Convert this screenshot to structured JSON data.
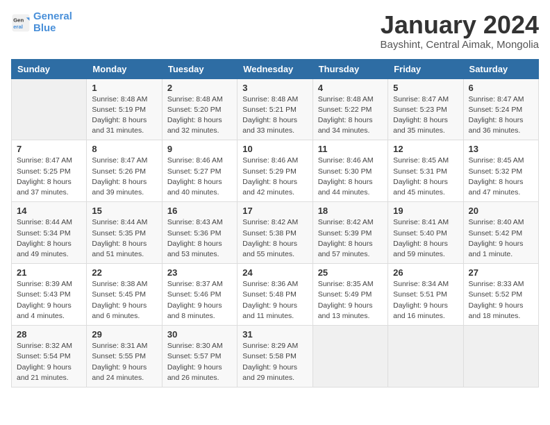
{
  "logo": {
    "line1": "General",
    "line2": "Blue"
  },
  "title": "January 2024",
  "subtitle": "Bayshint, Central Aimak, Mongolia",
  "days_header": [
    "Sunday",
    "Monday",
    "Tuesday",
    "Wednesday",
    "Thursday",
    "Friday",
    "Saturday"
  ],
  "weeks": [
    [
      {
        "num": "",
        "sunrise": "",
        "sunset": "",
        "daylight": ""
      },
      {
        "num": "1",
        "sunrise": "Sunrise: 8:48 AM",
        "sunset": "Sunset: 5:19 PM",
        "daylight": "Daylight: 8 hours and 31 minutes."
      },
      {
        "num": "2",
        "sunrise": "Sunrise: 8:48 AM",
        "sunset": "Sunset: 5:20 PM",
        "daylight": "Daylight: 8 hours and 32 minutes."
      },
      {
        "num": "3",
        "sunrise": "Sunrise: 8:48 AM",
        "sunset": "Sunset: 5:21 PM",
        "daylight": "Daylight: 8 hours and 33 minutes."
      },
      {
        "num": "4",
        "sunrise": "Sunrise: 8:48 AM",
        "sunset": "Sunset: 5:22 PM",
        "daylight": "Daylight: 8 hours and 34 minutes."
      },
      {
        "num": "5",
        "sunrise": "Sunrise: 8:47 AM",
        "sunset": "Sunset: 5:23 PM",
        "daylight": "Daylight: 8 hours and 35 minutes."
      },
      {
        "num": "6",
        "sunrise": "Sunrise: 8:47 AM",
        "sunset": "Sunset: 5:24 PM",
        "daylight": "Daylight: 8 hours and 36 minutes."
      }
    ],
    [
      {
        "num": "7",
        "sunrise": "Sunrise: 8:47 AM",
        "sunset": "Sunset: 5:25 PM",
        "daylight": "Daylight: 8 hours and 37 minutes."
      },
      {
        "num": "8",
        "sunrise": "Sunrise: 8:47 AM",
        "sunset": "Sunset: 5:26 PM",
        "daylight": "Daylight: 8 hours and 39 minutes."
      },
      {
        "num": "9",
        "sunrise": "Sunrise: 8:46 AM",
        "sunset": "Sunset: 5:27 PM",
        "daylight": "Daylight: 8 hours and 40 minutes."
      },
      {
        "num": "10",
        "sunrise": "Sunrise: 8:46 AM",
        "sunset": "Sunset: 5:29 PM",
        "daylight": "Daylight: 8 hours and 42 minutes."
      },
      {
        "num": "11",
        "sunrise": "Sunrise: 8:46 AM",
        "sunset": "Sunset: 5:30 PM",
        "daylight": "Daylight: 8 hours and 44 minutes."
      },
      {
        "num": "12",
        "sunrise": "Sunrise: 8:45 AM",
        "sunset": "Sunset: 5:31 PM",
        "daylight": "Daylight: 8 hours and 45 minutes."
      },
      {
        "num": "13",
        "sunrise": "Sunrise: 8:45 AM",
        "sunset": "Sunset: 5:32 PM",
        "daylight": "Daylight: 8 hours and 47 minutes."
      }
    ],
    [
      {
        "num": "14",
        "sunrise": "Sunrise: 8:44 AM",
        "sunset": "Sunset: 5:34 PM",
        "daylight": "Daylight: 8 hours and 49 minutes."
      },
      {
        "num": "15",
        "sunrise": "Sunrise: 8:44 AM",
        "sunset": "Sunset: 5:35 PM",
        "daylight": "Daylight: 8 hours and 51 minutes."
      },
      {
        "num": "16",
        "sunrise": "Sunrise: 8:43 AM",
        "sunset": "Sunset: 5:36 PM",
        "daylight": "Daylight: 8 hours and 53 minutes."
      },
      {
        "num": "17",
        "sunrise": "Sunrise: 8:42 AM",
        "sunset": "Sunset: 5:38 PM",
        "daylight": "Daylight: 8 hours and 55 minutes."
      },
      {
        "num": "18",
        "sunrise": "Sunrise: 8:42 AM",
        "sunset": "Sunset: 5:39 PM",
        "daylight": "Daylight: 8 hours and 57 minutes."
      },
      {
        "num": "19",
        "sunrise": "Sunrise: 8:41 AM",
        "sunset": "Sunset: 5:40 PM",
        "daylight": "Daylight: 8 hours and 59 minutes."
      },
      {
        "num": "20",
        "sunrise": "Sunrise: 8:40 AM",
        "sunset": "Sunset: 5:42 PM",
        "daylight": "Daylight: 9 hours and 1 minute."
      }
    ],
    [
      {
        "num": "21",
        "sunrise": "Sunrise: 8:39 AM",
        "sunset": "Sunset: 5:43 PM",
        "daylight": "Daylight: 9 hours and 4 minutes."
      },
      {
        "num": "22",
        "sunrise": "Sunrise: 8:38 AM",
        "sunset": "Sunset: 5:45 PM",
        "daylight": "Daylight: 9 hours and 6 minutes."
      },
      {
        "num": "23",
        "sunrise": "Sunrise: 8:37 AM",
        "sunset": "Sunset: 5:46 PM",
        "daylight": "Daylight: 9 hours and 8 minutes."
      },
      {
        "num": "24",
        "sunrise": "Sunrise: 8:36 AM",
        "sunset": "Sunset: 5:48 PM",
        "daylight": "Daylight: 9 hours and 11 minutes."
      },
      {
        "num": "25",
        "sunrise": "Sunrise: 8:35 AM",
        "sunset": "Sunset: 5:49 PM",
        "daylight": "Daylight: 9 hours and 13 minutes."
      },
      {
        "num": "26",
        "sunrise": "Sunrise: 8:34 AM",
        "sunset": "Sunset: 5:51 PM",
        "daylight": "Daylight: 9 hours and 16 minutes."
      },
      {
        "num": "27",
        "sunrise": "Sunrise: 8:33 AM",
        "sunset": "Sunset: 5:52 PM",
        "daylight": "Daylight: 9 hours and 18 minutes."
      }
    ],
    [
      {
        "num": "28",
        "sunrise": "Sunrise: 8:32 AM",
        "sunset": "Sunset: 5:54 PM",
        "daylight": "Daylight: 9 hours and 21 minutes."
      },
      {
        "num": "29",
        "sunrise": "Sunrise: 8:31 AM",
        "sunset": "Sunset: 5:55 PM",
        "daylight": "Daylight: 9 hours and 24 minutes."
      },
      {
        "num": "30",
        "sunrise": "Sunrise: 8:30 AM",
        "sunset": "Sunset: 5:57 PM",
        "daylight": "Daylight: 9 hours and 26 minutes."
      },
      {
        "num": "31",
        "sunrise": "Sunrise: 8:29 AM",
        "sunset": "Sunset: 5:58 PM",
        "daylight": "Daylight: 9 hours and 29 minutes."
      },
      {
        "num": "",
        "sunrise": "",
        "sunset": "",
        "daylight": ""
      },
      {
        "num": "",
        "sunrise": "",
        "sunset": "",
        "daylight": ""
      },
      {
        "num": "",
        "sunrise": "",
        "sunset": "",
        "daylight": ""
      }
    ]
  ]
}
